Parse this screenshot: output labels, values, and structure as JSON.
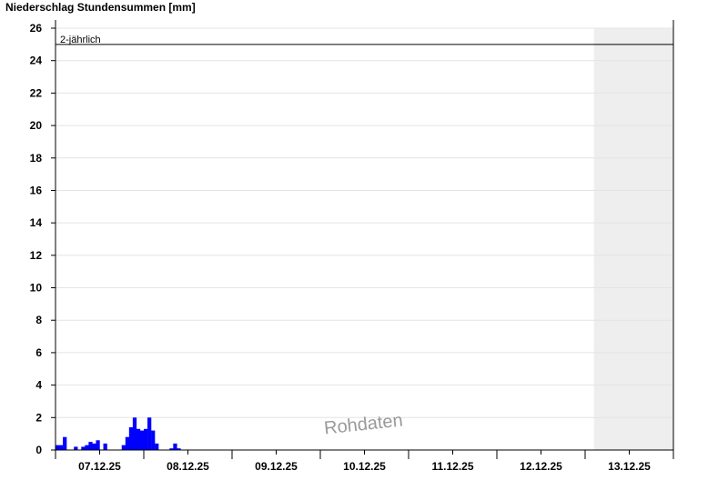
{
  "chart_data": {
    "type": "bar",
    "title": "Niederschlag Stundensummen [mm]",
    "xlabel": "",
    "ylabel": "",
    "ylim": [
      0,
      26
    ],
    "yticks": [
      0,
      2,
      4,
      6,
      8,
      10,
      12,
      14,
      16,
      18,
      20,
      22,
      24,
      26
    ],
    "x_range_days": [
      -0.5,
      6.5
    ],
    "xtick_labels": [
      "07.12.25",
      "08.12.25",
      "09.12.25",
      "10.12.25",
      "11.12.25",
      "12.12.25",
      "13.12.25"
    ],
    "forecast_start_day": 5.6,
    "reference_line": {
      "label": "2-jährlich",
      "value": 25
    },
    "watermark": "Rohdaten",
    "grid": "horizontal",
    "colors": {
      "bars": "#0000ff",
      "forecast_region": "#eeeeee",
      "grid": "#e4e4e4",
      "reference": "#000000"
    },
    "series": [
      {
        "hours_from_start": [
          0,
          1,
          2,
          3,
          4,
          5,
          6,
          7,
          8,
          9,
          10,
          11,
          12,
          13,
          14,
          15,
          16,
          17,
          18,
          19,
          20,
          21,
          22,
          23,
          24,
          25,
          26,
          27,
          28,
          29,
          30,
          31,
          32,
          33,
          34,
          35,
          36
        ],
        "values": [
          0.3,
          0.3,
          0.8,
          0,
          0,
          0.2,
          0.0,
          0.2,
          0.3,
          0.5,
          0.4,
          0.6,
          0,
          0.4,
          0,
          0,
          0,
          0,
          0.3,
          0.8,
          1.4,
          2.0,
          1.3,
          1.2,
          1.3,
          2.0,
          1.2,
          0.4,
          0,
          0,
          0,
          0.1,
          0.4,
          0.1,
          0,
          0,
          0
        ]
      }
    ]
  }
}
